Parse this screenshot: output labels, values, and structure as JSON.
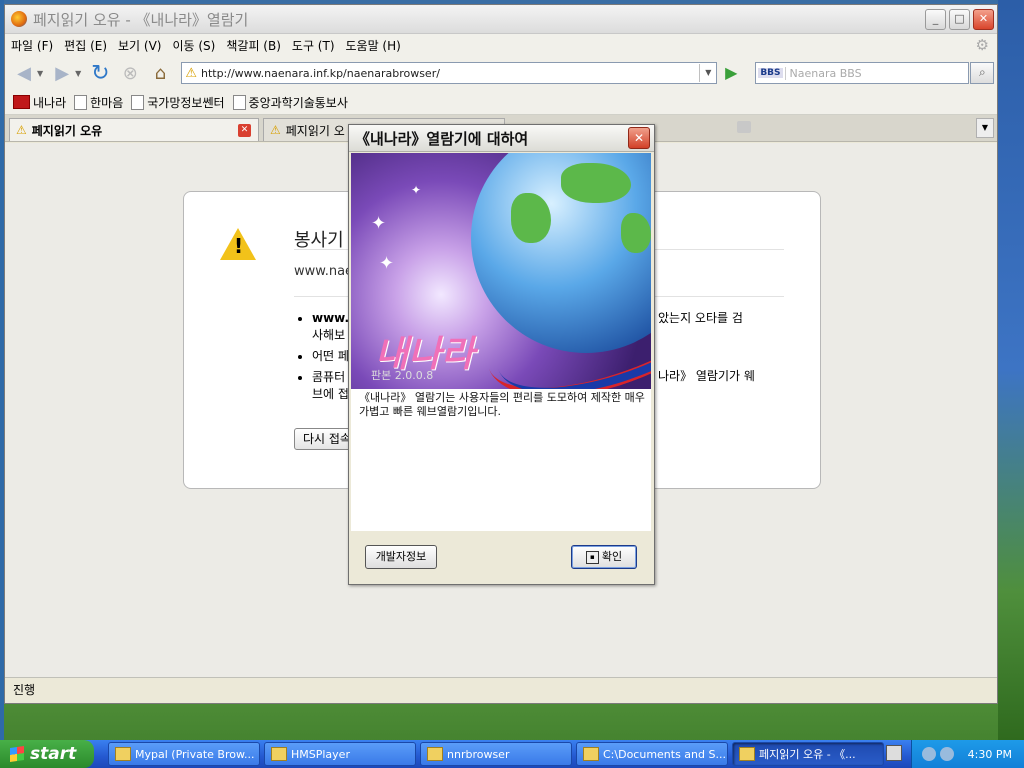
{
  "window": {
    "title": "페지읽기 오유 - 《내나라》열람기"
  },
  "menu": [
    "파일 (F)",
    "편집 (E)",
    "보기 (V)",
    "이동 (S)",
    "책갈피 (B)",
    "도구 (T)",
    "도움말 (H)"
  ],
  "nav": {
    "url": "http://www.naenara.inf.kp/naenarabrowser/",
    "search_engine": "BBS",
    "search_placeholder": "Naenara BBS"
  },
  "bookmarks": [
    "내나라",
    "한마음",
    "국가망정보쎈터",
    "중앙과학기술통보사"
  ],
  "tabs": [
    {
      "label": "페지읽기 오유",
      "active": true
    },
    {
      "label": "페지읽기 오",
      "active": false
    }
  ],
  "error_page": {
    "heading": "봉사기",
    "address": "www.nae",
    "bullets": [
      "www.",
      "사해보",
      "어떤 페",
      "콤퓨터",
      "브에 접"
    ],
    "bullets_right": [
      "았는지 오타를 검",
      "나라》 열람기가 웨"
    ],
    "retry_label": "다시 접속"
  },
  "dialog": {
    "title": "《내나라》열람기에 대하여",
    "brand": "내나라",
    "version_label": "판본 2.0.0.8",
    "description": "《내나라》 열람기는 사용자들의 편리를 도모하여 제작한 매우 가볍고 빠른 웨브열람기입니다.",
    "dev_button": "개발자정보",
    "ok_button": "확인"
  },
  "status": {
    "text": "진행"
  },
  "taskbar": {
    "start": "start",
    "items": [
      "Mypal (Private Brow...",
      "HMSPlayer",
      "nnrbrowser",
      "C:\\Documents and S...",
      "페지읽기 오유 - 《..."
    ],
    "clock": "4:30 PM"
  }
}
